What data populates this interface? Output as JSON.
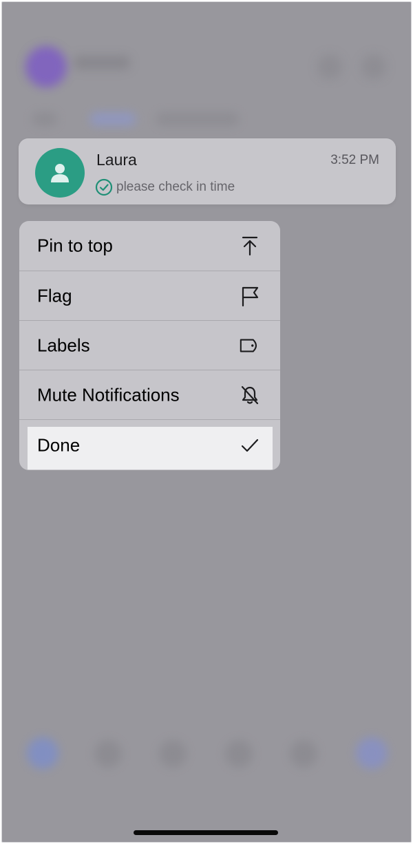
{
  "chat": {
    "name": "Laura",
    "time": "3:52 PM",
    "preview": "please check in time"
  },
  "menu": {
    "items": [
      {
        "label": "Pin to top",
        "icon": "pin-to-top-icon"
      },
      {
        "label": "Flag",
        "icon": "flag-icon"
      },
      {
        "label": "Labels",
        "icon": "label-tag-icon"
      },
      {
        "label": "Mute Notifications",
        "icon": "bell-slash-icon"
      },
      {
        "label": "Done",
        "icon": "checkmark-icon"
      }
    ],
    "selected_index": 4
  },
  "colors": {
    "avatar": "#2b9d84",
    "overlay": "#98979d",
    "menu_background": "#c6c5ca",
    "selected_row": "#efeff1"
  }
}
